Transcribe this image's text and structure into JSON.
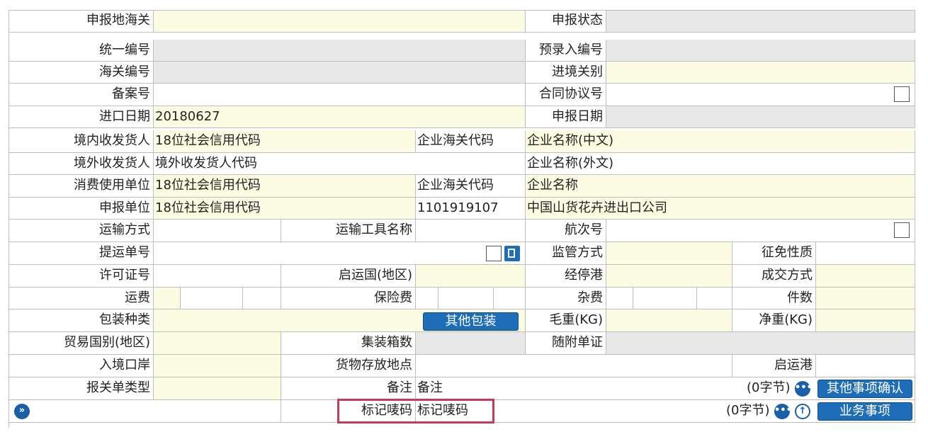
{
  "labels": {
    "declare_customs": "申报地海关",
    "declare_status": "申报状态",
    "unified_no": "统一编号",
    "pre_entry_no": "预录入编号",
    "customs_no": "海关编号",
    "entry_customs": "进境关别",
    "record_no": "备案号",
    "contract_no": "合同协议号",
    "import_date": "进口日期",
    "declare_date": "申报日期",
    "domestic_consignee": "境内收发货人",
    "overseas_consignee": "境外收发货人",
    "consumer_unit": "消费使用单位",
    "declare_unit": "申报单位",
    "transport_mode": "运输方式",
    "transport_name": "运输工具名称",
    "voyage_no": "航次号",
    "bill_no": "提运单号",
    "supervision_mode": "监管方式",
    "exemption_nature": "征免性质",
    "license_no": "许可证号",
    "origin_country": "启运国(地区)",
    "transit_port": "经停港",
    "deal_mode": "成交方式",
    "freight": "运费",
    "insurance": "保险费",
    "misc_fee": "杂费",
    "pieces": "件数",
    "package_type": "包装种类",
    "gross_weight": "毛重(KG)",
    "net_weight": "净重(KG)",
    "trade_country": "贸易国别(地区)",
    "container_count": "集装箱数",
    "attached_docs": "随附单证",
    "entry_port": "入境口岸",
    "goods_location": "货物存放地点",
    "departure_port": "启运港",
    "declaration_type": "报关单类型",
    "remarks": "备注",
    "marks_numbers": "标记唛码"
  },
  "values": {
    "import_date": "20180627",
    "domestic_credit": "18位社会信用代码",
    "domestic_customs_code_label": "企业海关代码",
    "domestic_name": "企业名称(中文)",
    "overseas_code": "境外收发货人代码",
    "overseas_name": "企业名称(外文)",
    "consumer_credit": "18位社会信用代码",
    "consumer_customs_code_label": "企业海关代码",
    "consumer_name": "企业名称",
    "declare_credit": "18位社会信用代码",
    "declare_customs_code": "1101919107",
    "declare_name": "中国山货花卉进出口公司",
    "remarks": "备注",
    "marks_numbers": "标记唛码"
  },
  "buttons": {
    "other_packaging": "其他包装",
    "other_confirm": "其他事项确认",
    "business_items": "业务事项"
  },
  "counters": {
    "remarks_bytes": "(0字节)",
    "marks_bytes": "(0字节)"
  },
  "icons": {
    "expand": "»",
    "more": "•••",
    "upload": "↑"
  },
  "colors": {
    "required_bg": "#fcfce2",
    "readonly_bg": "#e8e8e8",
    "button_bg": "#1d6db8",
    "highlight": "#c83b57"
  }
}
